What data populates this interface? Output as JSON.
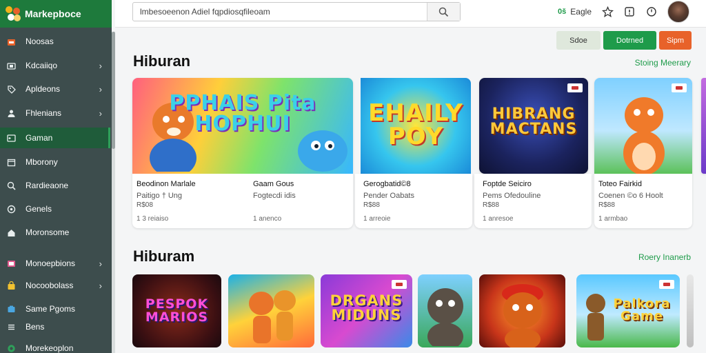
{
  "app": {
    "title": "Markepboce",
    "accent": "#1e9b4a",
    "sidebar_bg": "#3d4d4d",
    "brand_bg": "#1e7a3c"
  },
  "sidebar": {
    "items": [
      {
        "label": "Noosas",
        "icon": "store-icon",
        "chevron": false,
        "active": false
      },
      {
        "label": "Kdcaiiqo",
        "icon": "camera-icon",
        "chevron": true,
        "active": false
      },
      {
        "label": "Apldeons",
        "icon": "tag-icon",
        "chevron": true,
        "active": false
      },
      {
        "label": "Fhlenians",
        "icon": "users-icon",
        "chevron": true,
        "active": false
      },
      {
        "label": "Gaman",
        "icon": "gamepad-icon",
        "chevron": false,
        "active": true
      },
      {
        "label": "Mborony",
        "icon": "calendar-icon",
        "chevron": false,
        "active": false
      },
      {
        "label": "Rardieaone",
        "icon": "search-icon",
        "chevron": false,
        "active": false
      },
      {
        "label": "Genels",
        "icon": "settings-icon",
        "chevron": false,
        "active": false
      },
      {
        "label": "Moronsome",
        "icon": "home-icon",
        "chevron": false,
        "active": false
      },
      {
        "label": "Monoepbions",
        "icon": "film-icon",
        "chevron": true,
        "active": false
      },
      {
        "label": "Nocoobolass",
        "icon": "bag-icon",
        "chevron": true,
        "active": false
      },
      {
        "label": "Same Pgoms",
        "icon": "box-icon",
        "chevron": false,
        "active": false
      },
      {
        "label": "Bens",
        "icon": "list-icon",
        "chevron": false,
        "active": false
      },
      {
        "label": "Morekeoplon",
        "icon": "globe-icon",
        "chevron": false,
        "active": false
      }
    ]
  },
  "header": {
    "search_value": "lmbesoeenon Adiel fqpdiosqfileoam",
    "badge": "0š",
    "label": "Eagle",
    "icons": [
      "star-icon",
      "notification-icon",
      "clock-icon"
    ]
  },
  "actions": {
    "side": "Sdoe",
    "download": "Dotrned",
    "open": "Sipm"
  },
  "section1": {
    "title": "Hiburan",
    "link": "Stoing Meerary",
    "cards": [
      {
        "art": "PPHAIS Pita HOPHUI",
        "line1": "Beodinon Marlale",
        "line2": "Paitigo † Ung",
        "price": "R$08",
        "meta": "1 3 reiaiso"
      },
      {
        "art": "EHAILY POY",
        "line1": "Gaam Gous",
        "line2": "Fogtecdi idis",
        "price": "",
        "meta": "1 anenco"
      },
      {
        "art": "HIBRANG MACTANS",
        "line1": "Gerogbatid©8",
        "line2": "Pender Oabats",
        "price": "R$88",
        "meta": "1 arreoie"
      },
      {
        "art": "",
        "line1": "Foptde Seiciro",
        "line2": "Pems Ofedouline",
        "price": "R$88",
        "meta": "1 anresoe"
      },
      {
        "art": "",
        "line1": "Toteo Fairkid",
        "line2": "Coenen ©o 6 Hoolt",
        "price": "R$88",
        "meta": "1 armbao"
      }
    ]
  },
  "section2": {
    "title": "Hiburam",
    "link": "Roery Inanerb",
    "tiles": [
      {
        "art": "PESPOK MARIOS"
      },
      {
        "art": ""
      },
      {
        "art": "DRGANS MIDUNS"
      },
      {
        "art": ""
      },
      {
        "art": ""
      },
      {
        "art": "Palkora Game"
      }
    ]
  }
}
